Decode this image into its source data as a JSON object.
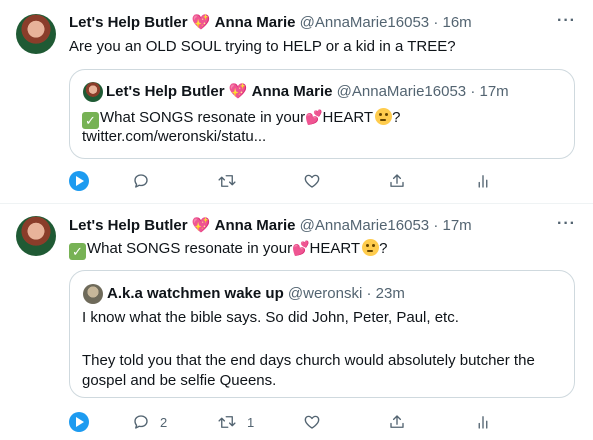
{
  "tweets": [
    {
      "author_name": "Let's Help Butler",
      "author_heart": "💖",
      "author_name2": "Anna Marie",
      "handle": "@AnnaMarie16053",
      "time": "16m",
      "dot": "·",
      "more": "···",
      "text": "Are you an OLD SOUL trying to HELP or a kid in a TREE?",
      "quote": {
        "author_name": "Let's Help Butler",
        "author_heart": "💖",
        "author_name2": "Anna Marie",
        "handle": "@AnnaMarie16053",
        "time": "17m",
        "dot": "·",
        "check": "✓",
        "line1_a": "What SONGS resonate in your",
        "line1_heart": "💕",
        "line1_b": "HEART",
        "line1_c": "?",
        "line2": "twitter.com/weronski/statu..."
      },
      "actions": {
        "reply_count": "",
        "retweet_count": "",
        "like_count": ""
      }
    },
    {
      "author_name": "Let's Help Butler",
      "author_heart": "💖",
      "author_name2": "Anna Marie",
      "handle": "@AnnaMarie16053",
      "time": "17m",
      "dot": "·",
      "more": "···",
      "check": "✓",
      "text_a": "What SONGS resonate in your",
      "text_heart": "💕",
      "text_b": "HEART",
      "text_c": "?",
      "quote": {
        "author_name": "A.k.a watchmen wake up",
        "handle": "@weronski",
        "time": "23m",
        "dot": "·",
        "line1": "I know what the bible says. So did John, Peter, Paul, etc.",
        "line2": "They told you that the end days church would absolutely butcher the",
        "line3": "gospel and be selfie Queens."
      },
      "actions": {
        "reply_count": "2",
        "retweet_count": "1",
        "like_count": ""
      }
    }
  ],
  "colors": {
    "accent": "#1d9bf0",
    "muted": "#536471",
    "border": "#cfd9de"
  }
}
